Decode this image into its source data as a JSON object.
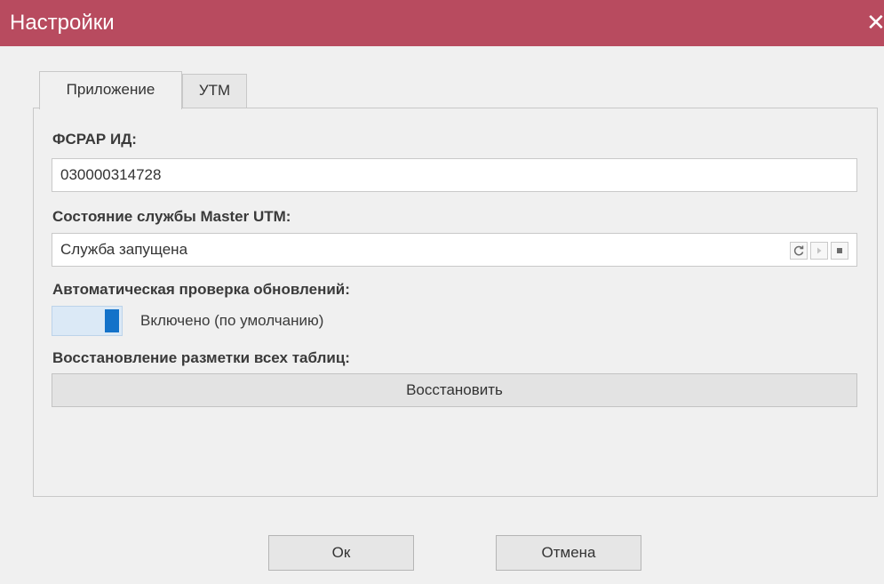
{
  "window": {
    "title": "Настройки",
    "close_symbol": "✕"
  },
  "tabs": [
    {
      "label": "Приложение",
      "active": true
    },
    {
      "label": "УТМ",
      "active": false
    }
  ],
  "fsrar": {
    "label": "ФСРАР ИД:",
    "value": "030000314728"
  },
  "service": {
    "label": "Состояние службы Master UTM:",
    "value": "Служба запущена",
    "icons": [
      "refresh-icon",
      "play-icon",
      "stop-icon"
    ]
  },
  "auto_update": {
    "label": "Автоматическая проверка обновлений:",
    "toggle_on": true,
    "status_text": "Включено (по умолчанию)"
  },
  "restore": {
    "label": "Восстановление разметки всех таблиц:",
    "button_label": "Восстановить"
  },
  "footer": {
    "ok_label": "Ок",
    "cancel_label": "Отмена"
  },
  "colors": {
    "titlebar": "#b84b5f",
    "toggle_knob": "#1372c9",
    "toggle_track": "#dbe9f6"
  }
}
